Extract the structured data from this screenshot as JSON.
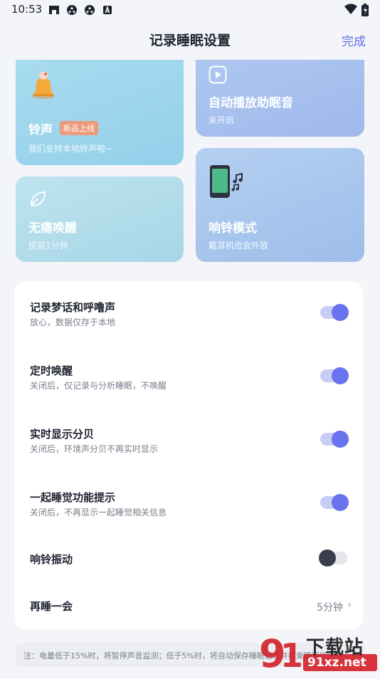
{
  "status_bar": {
    "time": "10:53"
  },
  "header": {
    "title": "记录睡眠设置",
    "done_label": "完成"
  },
  "cards": {
    "bell": {
      "title": "铃声",
      "badge": "新品上线",
      "subtitle": "我们支持本地铃声啦~",
      "icon": "bell-icon"
    },
    "audio": {
      "title": "自动播放助眠音",
      "subtitle": "未开启",
      "icon": "play-icon"
    },
    "painless": {
      "title": "无痛唤醒",
      "subtitle": "提前1分钟",
      "icon": "leaf-icon"
    },
    "ring_mode": {
      "title": "响铃模式",
      "subtitle": "戴耳机也会外放",
      "icon": "phone-music-icon"
    }
  },
  "settings": [
    {
      "title": "记录梦话和呼噜声",
      "subtitle": "放心，数据仅存于本地",
      "toggle": true
    },
    {
      "title": "定时唤醒",
      "subtitle": "关闭后，仅记录与分析睡眠，不唤醒",
      "toggle": true
    },
    {
      "title": "实时显示分贝",
      "subtitle": "关闭后，环境声分贝不再实时显示",
      "toggle": true
    },
    {
      "title": "一起睡觉功能提示",
      "subtitle": "关闭后，不再显示一起睡觉相关信息",
      "toggle": true
    },
    {
      "title": "响铃振动",
      "toggle": false
    },
    {
      "title": "再睡一会",
      "value": "5分钟"
    }
  ],
  "note": "注：电量低于15%时，将暂停声音监测；低于5%时，将自动保存睡眠记录并结束睡眠监测",
  "watermark": {
    "brand": "下载站",
    "site": "91xz.net"
  },
  "colors": {
    "accent": "#6a73ee",
    "done": "#6371e8"
  }
}
